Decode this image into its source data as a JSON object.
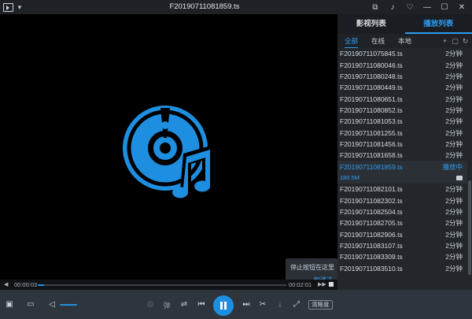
{
  "window": {
    "title": "F20190711081859.ts"
  },
  "title_icons": [
    "pin-icon",
    "bell-icon",
    "shirt-icon",
    "minimize-icon",
    "maximize-icon",
    "close-icon"
  ],
  "panel": {
    "tabs": [
      {
        "label": "影视列表",
        "active": false
      },
      {
        "label": "播放列表",
        "active": true
      }
    ],
    "subtabs": [
      {
        "label": "全部",
        "active": true
      },
      {
        "label": "在线",
        "active": false
      },
      {
        "label": "本地",
        "active": false
      }
    ],
    "items": [
      {
        "name": "F20190711075845.ts",
        "duration": "2分钟"
      },
      {
        "name": "F20190711080046.ts",
        "duration": "2分钟"
      },
      {
        "name": "F20190711080248.ts",
        "duration": "2分钟"
      },
      {
        "name": "F20190711080449.ts",
        "duration": "2分钟"
      },
      {
        "name": "F20190711080651.ts",
        "duration": "2分钟"
      },
      {
        "name": "F20190711080852.ts",
        "duration": "2分钟"
      },
      {
        "name": "F20190711081053.ts",
        "duration": "2分钟"
      },
      {
        "name": "F20190711081255.ts",
        "duration": "2分钟"
      },
      {
        "name": "F20190711081456.ts",
        "duration": "2分钟"
      },
      {
        "name": "F20190711081658.ts",
        "duration": "2分钟"
      }
    ],
    "current": {
      "name": "F20190711081859.ts",
      "status": "播放中",
      "size": "180.5M"
    },
    "items_after": [
      {
        "name": "F20190711082101.ts",
        "duration": "2分钟"
      },
      {
        "name": "F20190711082302.ts",
        "duration": "2分钟"
      },
      {
        "name": "F20190711082504.ts",
        "duration": "2分钟"
      },
      {
        "name": "F20190711082705.ts",
        "duration": "2分钟"
      },
      {
        "name": "F20190711082906.ts",
        "duration": "2分钟"
      },
      {
        "name": "F20190711083107.ts",
        "duration": "2分钟"
      },
      {
        "name": "F20190711083309.ts",
        "duration": "2分钟"
      },
      {
        "name": "F20190711083510.ts",
        "duration": "2分钟"
      }
    ]
  },
  "tip": {
    "text": "停止按钮在这里",
    "link": "知道了"
  },
  "progress": {
    "current_time": "00:00:03",
    "total_time": "00:02:01",
    "fraction": 0.025
  },
  "controls": {
    "volume_fraction": 1.0,
    "quality_label": "清晰度",
    "sub_label": "弹"
  },
  "colors": {
    "accent": "#1e8fe0",
    "background": "#000000",
    "panel": "#23272c"
  }
}
